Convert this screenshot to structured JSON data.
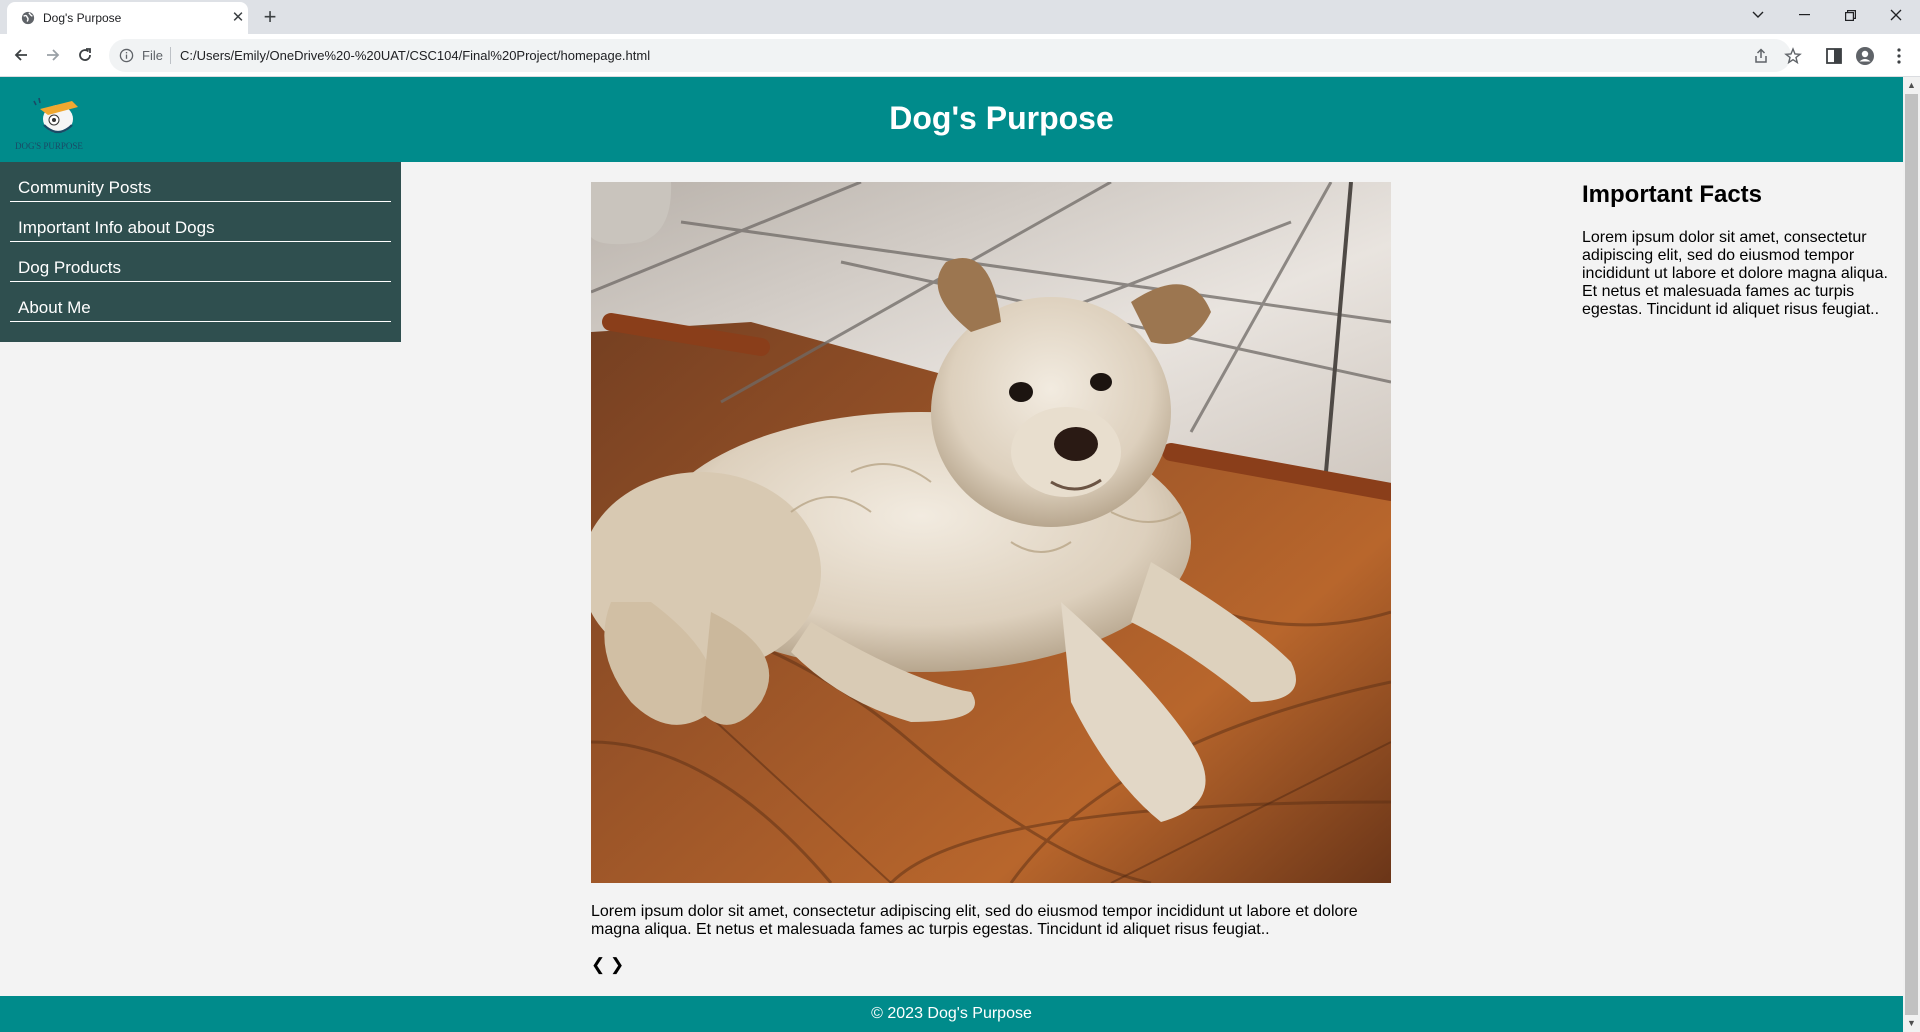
{
  "browser": {
    "tab_title": "Dog's Purpose",
    "tab_close": "✕",
    "new_tab": "+",
    "file_label": "File",
    "url": "C:/Users/Emily/OneDrive%20-%20UAT/CSC104/Final%20Project/homepage.html"
  },
  "header": {
    "title": "Dog's Purpose"
  },
  "sidebar": {
    "items": [
      {
        "label": "Community Posts"
      },
      {
        "label": "Important Info about Dogs"
      },
      {
        "label": "Dog Products"
      },
      {
        "label": "About Me"
      }
    ]
  },
  "main": {
    "text": "Lorem ipsum dolor sit amet, consectetur adipiscing elit, sed do eiusmod tempor incididunt ut labore et dolore magna aliqua. Et netus et malesuada fames ac turpis egestas. Tincidunt id aliquet risus feugiat..",
    "prev": "❮",
    "next": "❯"
  },
  "facts": {
    "title": "Important Facts",
    "text": "Lorem ipsum dolor sit amet, consectetur adipiscing elit, sed do eiusmod tempor incididunt ut labore et dolore magna aliqua. Et netus et malesuada fames ac turpis egestas. Tincidunt id aliquet risus feugiat.."
  },
  "footer": {
    "text": "© 2023 Dog's Purpose"
  },
  "colors": {
    "header": "#008b8b",
    "sidebar": "#2f4f4f",
    "page_bg": "#f3f3f3"
  }
}
